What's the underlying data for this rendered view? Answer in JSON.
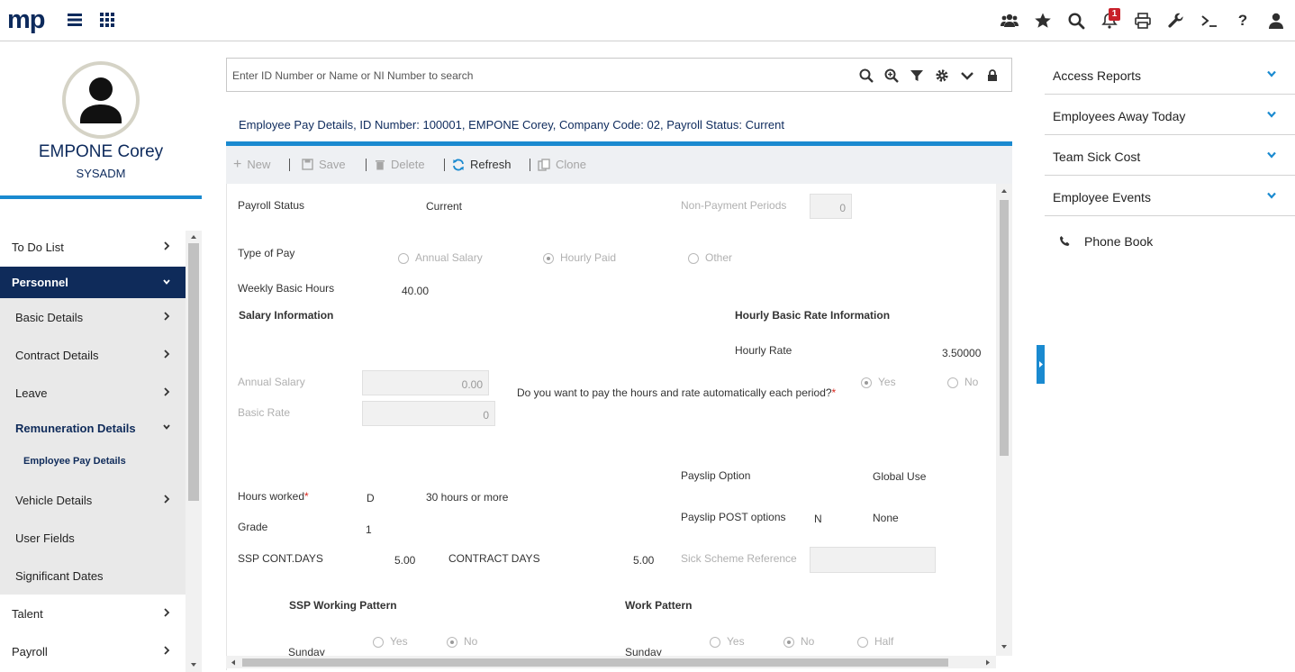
{
  "app": {
    "logo": "mp",
    "notification_count": "1"
  },
  "top_icons": [
    "team-icon",
    "star-icon",
    "search-icon",
    "bell-icon",
    "print-icon",
    "wrench-icon",
    "terminal-icon",
    "help-icon",
    "user-icon"
  ],
  "employee": {
    "name": "EMPONE Corey",
    "role": "SYSADM"
  },
  "sidebar": {
    "items": [
      {
        "label": "To Do List"
      },
      {
        "label": "Personnel"
      },
      {
        "label": "Basic Details"
      },
      {
        "label": "Contract Details"
      },
      {
        "label": "Leave"
      },
      {
        "label": "Remuneration Details"
      },
      {
        "label": "Employee Pay Details"
      },
      {
        "label": "Vehicle Details"
      },
      {
        "label": "User Fields"
      },
      {
        "label": "Significant Dates"
      },
      {
        "label": "Talent"
      },
      {
        "label": "Payroll"
      }
    ]
  },
  "search": {
    "placeholder": "Enter ID Number or Name or NI Number to search"
  },
  "page_title": "Employee Pay Details, ID Number: 100001, EMPONE Corey, Company Code: 02, Payroll Status: Current",
  "toolbar": {
    "new": "New",
    "save": "Save",
    "delete": "Delete",
    "refresh": "Refresh",
    "clone": "Clone"
  },
  "form": {
    "payroll_status_label": "Payroll Status",
    "payroll_status_value": "Current",
    "non_payment_label": "Non-Payment Periods",
    "non_payment_value": "0",
    "type_of_pay_label": "Type of Pay",
    "type_of_pay_options": [
      "Annual Salary",
      "Hourly Paid",
      "Other"
    ],
    "type_of_pay_selected": "Hourly Paid",
    "weekly_hours_label": "Weekly Basic Hours",
    "weekly_hours_value": "40.00",
    "salary_info_heading": "Salary Information",
    "hourly_info_heading": "Hourly Basic Rate Information",
    "hourly_rate_label": "Hourly Rate",
    "hourly_rate_value": "3.50000",
    "annual_salary_label": "Annual Salary",
    "annual_salary_value": "0.00",
    "basic_rate_label": "Basic Rate",
    "basic_rate_value": "0",
    "auto_pay_question": "Do you want to pay the hours and rate automatically each period?",
    "auto_pay_yes": "Yes",
    "auto_pay_no": "No",
    "payslip_option_label": "Payslip Option",
    "payslip_option_value": "Global Use",
    "hours_worked_label": "Hours worked",
    "hours_worked_code": "D",
    "hours_worked_desc": "30 hours or more",
    "payslip_post_label": "Payslip POST options",
    "payslip_post_code": "N",
    "payslip_post_value": "None",
    "grade_label": "Grade",
    "grade_value": "1",
    "ssp_cont_label": "SSP CONT.DAYS",
    "ssp_cont_value": "5.00",
    "contract_days_label": "CONTRACT DAYS",
    "contract_days_value": "5.00",
    "sick_scheme_label": "Sick Scheme Reference",
    "ssp_pattern_heading": "SSP Working Pattern",
    "work_pattern_heading": "Work Pattern",
    "day_sunday": "Sunday",
    "ssp_opts": [
      "Yes",
      "No"
    ],
    "work_opts": [
      "Yes",
      "No",
      "Half"
    ]
  },
  "right_panel": {
    "access_reports": "Access Reports",
    "employees_away": "Employees Away Today",
    "team_sick_cost": "Team Sick Cost",
    "employee_events": "Employee Events",
    "phone_book": "Phone Book"
  },
  "colors": {
    "navy": "#0f2b5a",
    "accent_blue": "#1a8ad0",
    "badge_red": "#c8202a"
  }
}
